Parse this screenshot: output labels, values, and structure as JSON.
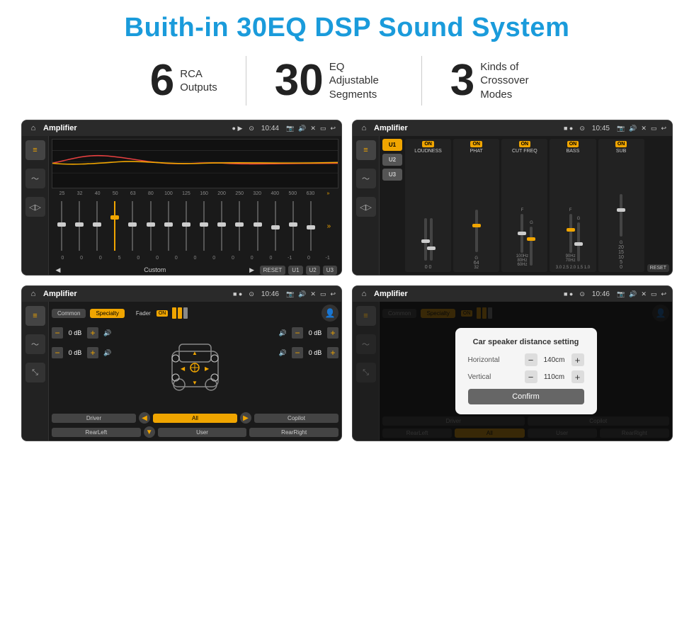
{
  "header": {
    "title": "Buith-in 30EQ DSP Sound System"
  },
  "stats": [
    {
      "number": "6",
      "label_line1": "RCA",
      "label_line2": "Outputs"
    },
    {
      "number": "30",
      "label_line1": "EQ Adjustable",
      "label_line2": "Segments"
    },
    {
      "number": "3",
      "label_line1": "Kinds of",
      "label_line2": "Crossover Modes"
    }
  ],
  "screen1": {
    "status_bar": {
      "title": "Amplifier",
      "time": "10:44"
    },
    "freq_labels": [
      "25",
      "32",
      "40",
      "50",
      "63",
      "80",
      "100",
      "125",
      "160",
      "200",
      "250",
      "320",
      "400",
      "500",
      "630"
    ],
    "eq_values": [
      "0",
      "0",
      "0",
      "5",
      "0",
      "0",
      "0",
      "0",
      "0",
      "0",
      "0",
      "0",
      "-1",
      "0",
      "-1"
    ],
    "preset": "Custom",
    "buttons": [
      "RESET",
      "U1",
      "U2",
      "U3"
    ]
  },
  "screen2": {
    "status_bar": {
      "title": "Amplifier",
      "time": "10:45"
    },
    "presets": [
      "U1",
      "U2",
      "U3"
    ],
    "controls": [
      {
        "name": "LOUDNESS",
        "on": true
      },
      {
        "name": "PHAT",
        "on": true
      },
      {
        "name": "CUT FREQ",
        "on": true
      },
      {
        "name": "BASS",
        "on": true
      },
      {
        "name": "SUB",
        "on": true
      }
    ],
    "reset_label": "RESET"
  },
  "screen3": {
    "status_bar": {
      "title": "Amplifier",
      "time": "10:46"
    },
    "tabs": [
      "Common",
      "Specialty"
    ],
    "fader_label": "Fader",
    "on_label": "ON",
    "db_controls": {
      "top_left": "0 dB",
      "top_right": "0 dB",
      "bottom_left": "0 dB",
      "bottom_right": "0 dB"
    },
    "bottom_buttons": [
      "Driver",
      "Copilot",
      "RearLeft",
      "All",
      "User",
      "RearRight"
    ]
  },
  "screen4": {
    "status_bar": {
      "title": "Amplifier",
      "time": "10:46"
    },
    "tabs": [
      "Common",
      "Specialty"
    ],
    "on_label": "ON",
    "dialog": {
      "title": "Car speaker distance setting",
      "horizontal_label": "Horizontal",
      "horizontal_value": "140cm",
      "vertical_label": "Vertical",
      "vertical_value": "110cm",
      "confirm_label": "Confirm"
    },
    "bottom_buttons": [
      "Driver",
      "Copilot",
      "RearLeft",
      "All",
      "User",
      "RearRight"
    ]
  }
}
